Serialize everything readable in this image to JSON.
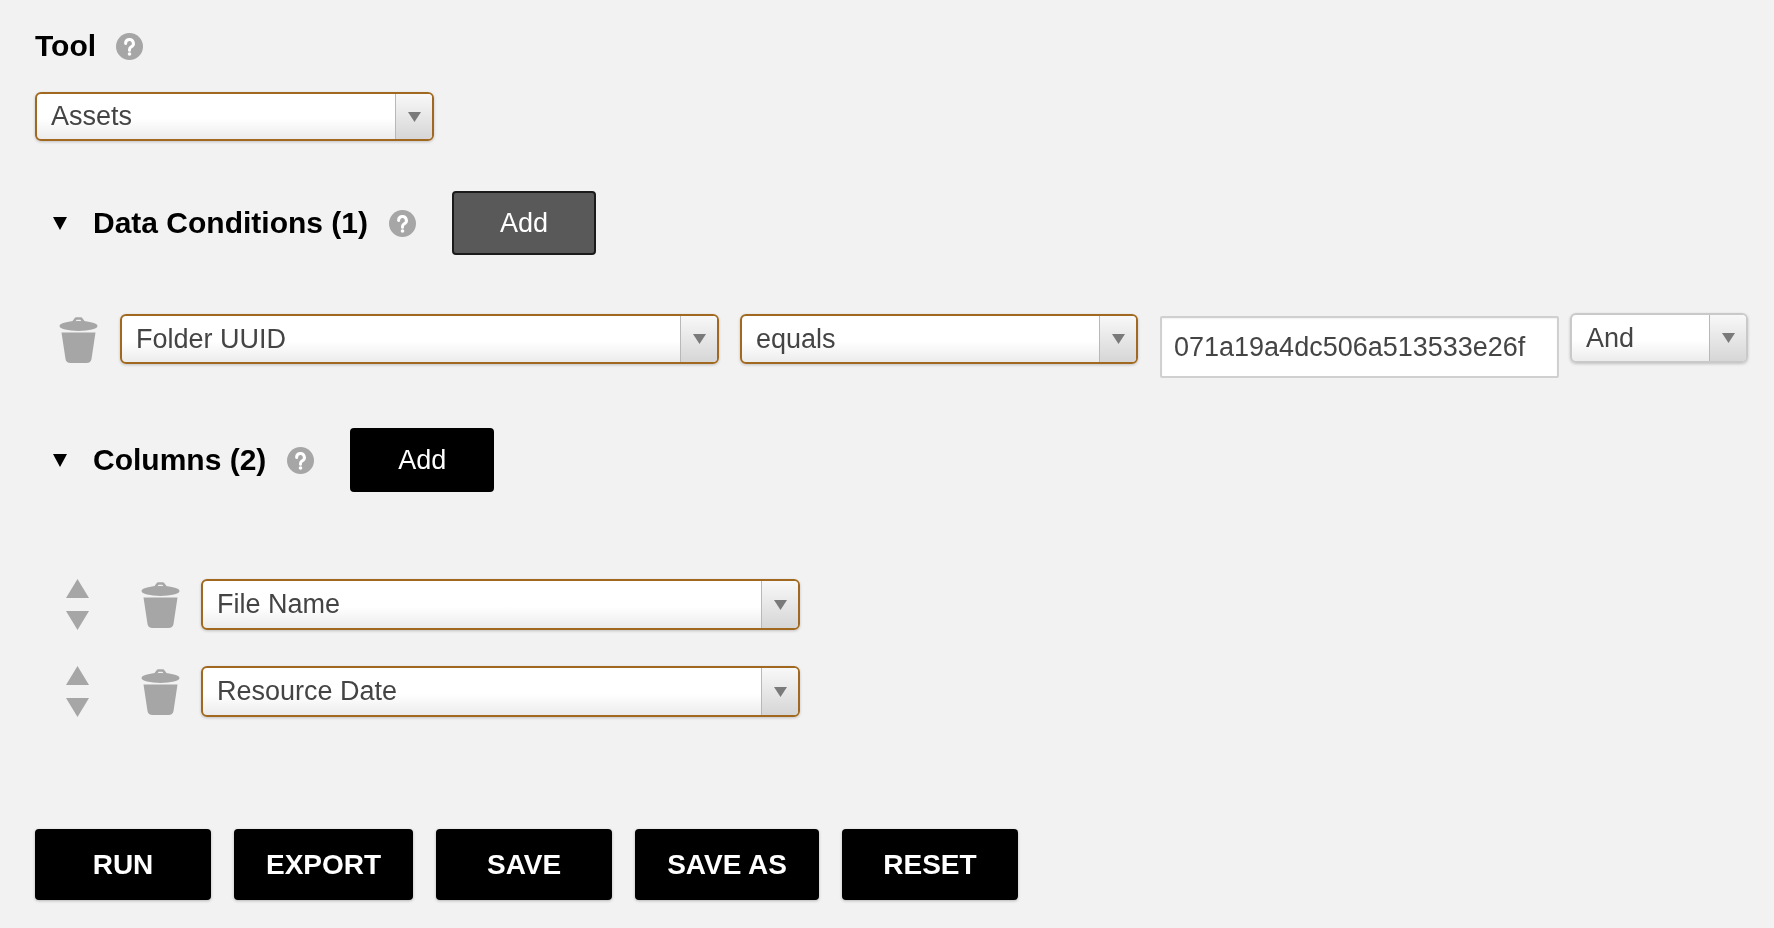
{
  "tool": {
    "label": "Tool",
    "value": "Assets",
    "highlighted": true
  },
  "sections": [
    {
      "kind": "conditions",
      "title": "Data Conditions (1)",
      "expanded": true,
      "add_button": {
        "label": "Add",
        "hovered": true
      },
      "conditions": [
        {
          "field": {
            "value": "Folder UUID",
            "highlighted": true
          },
          "operator": {
            "value": "equals",
            "highlighted": true
          },
          "input": {
            "value": "071a19a4dc506a513533e26f"
          },
          "joiner": {
            "value": "And",
            "highlighted": false
          }
        }
      ]
    },
    {
      "kind": "columns",
      "title": "Columns (2)",
      "expanded": true,
      "add_button": {
        "label": "Add",
        "hovered": false
      },
      "columns": [
        {
          "value": "File Name",
          "highlighted": true
        },
        {
          "value": "Resource Date",
          "highlighted": true
        }
      ]
    }
  ],
  "actions": [
    "RUN",
    "EXPORT",
    "SAVE",
    "SAVE AS",
    "RESET"
  ]
}
